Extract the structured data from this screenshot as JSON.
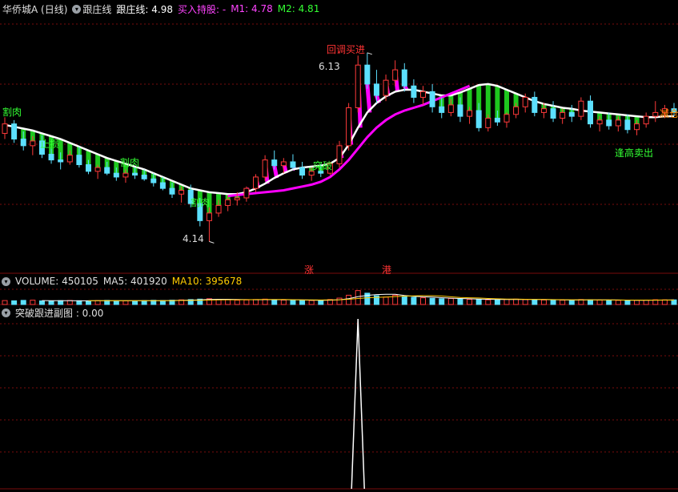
{
  "header": {
    "stock_name": "华侨城A (日线)",
    "indicator_name": "跟庄线",
    "main_line_label": "跟庄线: 4.98",
    "buy_hold_label": "买入持股: -",
    "m1_label": "M1: 4.78",
    "m2_label": "M2: 4.81"
  },
  "annotations": {
    "high_price": "6.13",
    "low_price": "4.14",
    "pullback_buy": "回调买进",
    "cut_left": "割肉",
    "cut_mid": "割肉",
    "cut_low": "割肉",
    "stop": "止损",
    "breakout": "突破",
    "reduce": "减仓",
    "sell_high": "逢高卖出",
    "rise_marker": "涨",
    "hk_marker": "港"
  },
  "volume_panel": {
    "volume_label": "VOLUME: 450105",
    "ma5_label": "MA5: 401920",
    "ma10_label": "MA10: 395678"
  },
  "sub_panel": {
    "title": "突破跟进副图 : 0.00"
  },
  "colors": {
    "background": "#000000",
    "up": "#ff3a3a",
    "down": "#5ce0ff",
    "white_line": "#ffffff",
    "magenta": "#ff00ff",
    "green": "#22dd22",
    "label_green": "#33ff33",
    "label_red": "#ff3333",
    "label_orange": "#ff8800",
    "ma10": "#ffcc00",
    "grid_red": "#7a0d0d"
  },
  "chart_data": {
    "type": "candlestick",
    "price_range": [
      4.0,
      6.5
    ],
    "price_series": [
      [
        5.28,
        5.45,
        5.22,
        5.38
      ],
      [
        5.38,
        5.42,
        5.18,
        5.22
      ],
      [
        5.22,
        5.3,
        5.1,
        5.15
      ],
      [
        5.15,
        5.25,
        5.05,
        5.2
      ],
      [
        5.2,
        5.26,
        5.02,
        5.06
      ],
      [
        5.06,
        5.12,
        4.96,
        5.0
      ],
      [
        5.0,
        5.08,
        4.9,
        4.98
      ],
      [
        4.98,
        5.1,
        4.95,
        5.05
      ],
      [
        5.05,
        5.14,
        4.92,
        4.95
      ],
      [
        4.95,
        5.0,
        4.85,
        4.88
      ],
      [
        4.88,
        4.95,
        4.8,
        4.92
      ],
      [
        4.92,
        4.98,
        4.84,
        4.86
      ],
      [
        4.86,
        4.92,
        4.78,
        4.82
      ],
      [
        4.82,
        4.9,
        4.76,
        4.86
      ],
      [
        4.86,
        4.92,
        4.8,
        4.84
      ],
      [
        4.84,
        4.9,
        4.78,
        4.8
      ],
      [
        4.8,
        4.86,
        4.72,
        4.76
      ],
      [
        4.76,
        4.82,
        4.68,
        4.7
      ],
      [
        4.7,
        4.76,
        4.6,
        4.64
      ],
      [
        4.64,
        4.72,
        4.55,
        4.68
      ],
      [
        4.68,
        4.74,
        4.5,
        4.54
      ],
      [
        4.54,
        4.6,
        4.3,
        4.36
      ],
      [
        4.36,
        4.5,
        4.14,
        4.44
      ],
      [
        4.44,
        4.58,
        4.4,
        4.52
      ],
      [
        4.52,
        4.62,
        4.46,
        4.58
      ],
      [
        4.58,
        4.66,
        4.52,
        4.6
      ],
      [
        4.6,
        4.72,
        4.56,
        4.7
      ],
      [
        4.7,
        4.85,
        4.66,
        4.82
      ],
      [
        4.82,
        5.05,
        4.78,
        5.0
      ],
      [
        5.0,
        5.1,
        4.9,
        4.94
      ],
      [
        4.94,
        5.02,
        4.86,
        4.98
      ],
      [
        4.98,
        5.06,
        4.9,
        4.92
      ],
      [
        4.92,
        4.98,
        4.8,
        4.84
      ],
      [
        4.84,
        4.92,
        4.78,
        4.88
      ],
      [
        4.88,
        4.96,
        4.82,
        4.86
      ],
      [
        4.86,
        4.98,
        4.84,
        4.96
      ],
      [
        4.96,
        5.2,
        4.92,
        5.15
      ],
      [
        5.15,
        5.6,
        5.1,
        5.55
      ],
      [
        5.55,
        6.1,
        5.5,
        6.0
      ],
      [
        6.0,
        6.13,
        5.75,
        5.8
      ],
      [
        5.8,
        5.95,
        5.6,
        5.68
      ],
      [
        5.68,
        5.9,
        5.62,
        5.84
      ],
      [
        5.84,
        6.05,
        5.78,
        5.95
      ],
      [
        5.95,
        6.02,
        5.72,
        5.78
      ],
      [
        5.78,
        5.85,
        5.6,
        5.66
      ],
      [
        5.66,
        5.78,
        5.58,
        5.72
      ],
      [
        5.72,
        5.8,
        5.5,
        5.56
      ],
      [
        5.56,
        5.66,
        5.44,
        5.5
      ],
      [
        5.5,
        5.64,
        5.46,
        5.58
      ],
      [
        5.58,
        5.66,
        5.4,
        5.46
      ],
      [
        5.46,
        5.56,
        5.38,
        5.52
      ],
      [
        5.52,
        5.6,
        5.3,
        5.34
      ],
      [
        5.34,
        5.48,
        5.3,
        5.44
      ],
      [
        5.44,
        5.52,
        5.36,
        5.4
      ],
      [
        5.4,
        5.5,
        5.34,
        5.48
      ],
      [
        5.48,
        5.6,
        5.44,
        5.56
      ],
      [
        5.56,
        5.7,
        5.5,
        5.66
      ],
      [
        5.66,
        5.72,
        5.46,
        5.5
      ],
      [
        5.5,
        5.6,
        5.44,
        5.54
      ],
      [
        5.54,
        5.62,
        5.4,
        5.44
      ],
      [
        5.44,
        5.54,
        5.38,
        5.5
      ],
      [
        5.5,
        5.58,
        5.4,
        5.46
      ],
      [
        5.46,
        5.66,
        5.42,
        5.62
      ],
      [
        5.62,
        5.68,
        5.34,
        5.38
      ],
      [
        5.38,
        5.46,
        5.3,
        5.42
      ],
      [
        5.42,
        5.5,
        5.32,
        5.36
      ],
      [
        5.36,
        5.46,
        5.3,
        5.42
      ],
      [
        5.42,
        5.48,
        5.28,
        5.32
      ],
      [
        5.32,
        5.42,
        5.26,
        5.38
      ],
      [
        5.38,
        5.5,
        5.34,
        5.46
      ],
      [
        5.46,
        5.62,
        5.4,
        5.5
      ],
      [
        5.5,
        5.58,
        5.44,
        5.54
      ],
      [
        5.54,
        5.6,
        5.46,
        5.5
      ]
    ],
    "white_line": [
      5.37,
      5.35,
      5.33,
      5.31,
      5.28,
      5.25,
      5.22,
      5.18,
      5.14,
      5.1,
      5.06,
      5.02,
      4.99,
      4.96,
      4.93,
      4.9,
      4.86,
      4.82,
      4.78,
      4.74,
      4.7,
      4.68,
      4.66,
      4.65,
      4.64,
      4.64,
      4.66,
      4.7,
      4.75,
      4.81,
      4.86,
      4.9,
      4.92,
      4.93,
      4.94,
      4.96,
      5.02,
      5.16,
      5.34,
      5.5,
      5.6,
      5.67,
      5.72,
      5.74,
      5.74,
      5.72,
      5.7,
      5.68,
      5.68,
      5.71,
      5.75,
      5.79,
      5.8,
      5.78,
      5.74,
      5.7,
      5.66,
      5.62,
      5.59,
      5.57,
      5.55,
      5.54,
      5.52,
      5.51,
      5.5,
      5.49,
      5.48,
      5.47,
      5.46,
      5.45,
      5.45,
      5.46,
      5.46
    ],
    "magenta_line": [
      null,
      null,
      null,
      null,
      null,
      null,
      null,
      null,
      null,
      null,
      null,
      null,
      null,
      null,
      null,
      null,
      null,
      null,
      null,
      null,
      null,
      null,
      null,
      null,
      4.62,
      4.63,
      4.64,
      4.65,
      4.66,
      4.67,
      4.68,
      4.7,
      4.72,
      4.74,
      4.77,
      4.82,
      4.9,
      5.0,
      5.12,
      5.24,
      5.34,
      5.42,
      5.48,
      5.52,
      5.55,
      5.58,
      5.62,
      5.66,
      5.7,
      5.74,
      5.78,
      null,
      null,
      null,
      null,
      null,
      null,
      null,
      null,
      null,
      null,
      null,
      null,
      null,
      null,
      null,
      null,
      null,
      null,
      null,
      null,
      null,
      null
    ],
    "volume": [
      380000,
      360000,
      400000,
      420000,
      350000,
      330000,
      370000,
      390000,
      360000,
      340000,
      380000,
      400000,
      360000,
      350000,
      340000,
      380000,
      410000,
      390000,
      420000,
      450000,
      480000,
      520000,
      560000,
      500000,
      460000,
      420000,
      440000,
      480000,
      520000,
      470000,
      430000,
      410000,
      400000,
      390000,
      420000,
      480000,
      620000,
      900000,
      1350000,
      1100000,
      850000,
      720000,
      900000,
      780000,
      700000,
      650000,
      600000,
      560000,
      580000,
      520000,
      500000,
      480000,
      450000,
      470000,
      500000,
      520000,
      480000,
      460000,
      440000,
      430000,
      420000,
      410000,
      480000,
      460000,
      430000,
      420000,
      400000,
      390000,
      410000,
      430000,
      460000,
      450000,
      450105
    ],
    "volume_range": [
      0,
      1400000
    ],
    "sub_signal": [
      0,
      0,
      0,
      0,
      0,
      0,
      0,
      0,
      0,
      0,
      0,
      0,
      0,
      0,
      0,
      0,
      0,
      0,
      0,
      0,
      0,
      0,
      0,
      0,
      0,
      0,
      0,
      0,
      0,
      0,
      0,
      0,
      0,
      0,
      0,
      0,
      0,
      0,
      1,
      0,
      0,
      0,
      0,
      0,
      0,
      0,
      0,
      0,
      0,
      0,
      0,
      0,
      0,
      0,
      0,
      0,
      0,
      0,
      0,
      0,
      0,
      0,
      0,
      0,
      0,
      0,
      0,
      0,
      0,
      0,
      0,
      0,
      0
    ],
    "sub_range": [
      0,
      1.0
    ]
  }
}
